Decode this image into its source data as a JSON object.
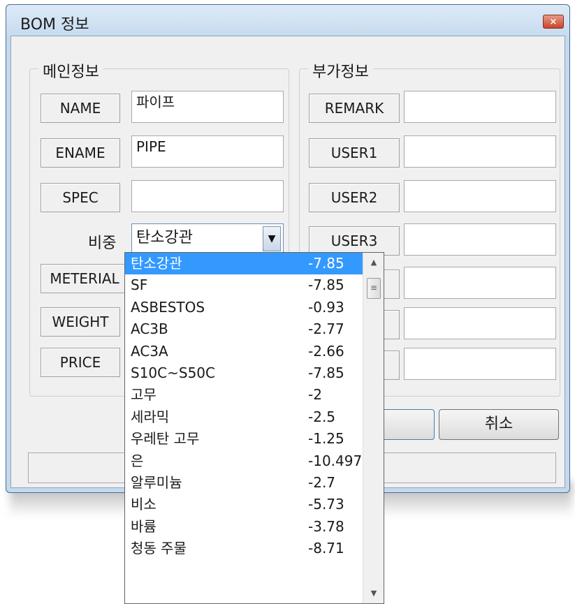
{
  "window": {
    "title": "BOM 정보",
    "close_glyph": "×"
  },
  "main_group": {
    "title": "메인정보",
    "name_label": "NAME",
    "name_value": "파이프",
    "ename_label": "ENAME",
    "ename_value": "PIPE",
    "spec_label": "SPEC",
    "spec_value": "",
    "density_label": "비중",
    "density_selected": "탄소강관",
    "meterial_label": "METERIAL",
    "weight_label": "WEIGHT",
    "price_label": "PRICE"
  },
  "extra_group": {
    "title": "부가정보",
    "remark_label": "REMARK",
    "user1_label": "USER1",
    "user2_label": "USER2",
    "user3_label": "USER3"
  },
  "buttons": {
    "cancel_label": "취소"
  },
  "icons": {
    "dropdown": "chevron-down-icon",
    "scroll_up": "scroll-up-icon",
    "scroll_down": "scroll-down-icon",
    "close": "close-icon"
  },
  "colors": {
    "selection": "#3399ff",
    "title_bar": "#c6dbef",
    "close_button": "#c8452c"
  },
  "dropdown_items": [
    {
      "name": "탄소강관",
      "value": "-7.85"
    },
    {
      "name": "SF",
      "value": "-7.85"
    },
    {
      "name": "ASBESTOS",
      "value": "-0.93"
    },
    {
      "name": "AC3B",
      "value": "-2.77"
    },
    {
      "name": "AC3A",
      "value": "-2.66"
    },
    {
      "name": "S10C~S50C",
      "value": "-7.85"
    },
    {
      "name": "고무",
      "value": "-2"
    },
    {
      "name": "세라믹",
      "value": "-2.5"
    },
    {
      "name": "우레탄 고무",
      "value": "-1.25"
    },
    {
      "name": "은",
      "value": "-10.497"
    },
    {
      "name": "알루미늄",
      "value": "-2.7"
    },
    {
      "name": "비소",
      "value": "-5.73"
    },
    {
      "name": "바륨",
      "value": "-3.78"
    },
    {
      "name": "청동 주물",
      "value": "-8.71"
    }
  ]
}
